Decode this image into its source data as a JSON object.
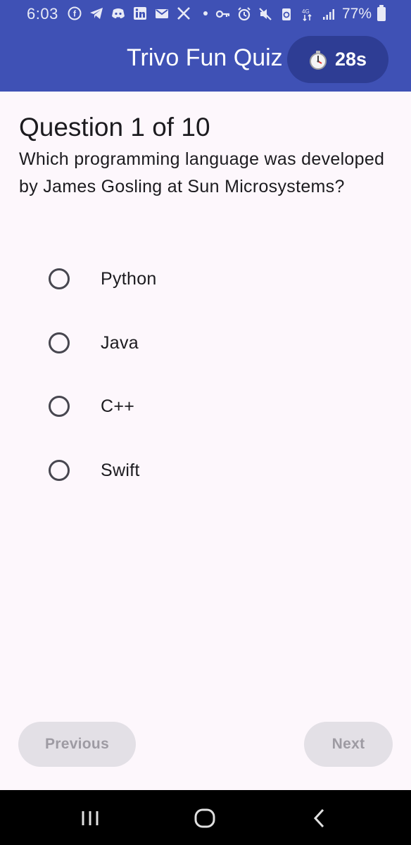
{
  "status_bar": {
    "time": "6:03",
    "battery_percent": "77%",
    "left_icons": [
      "facebook-icon",
      "telegram-icon",
      "discord-icon",
      "linkedin-icon",
      "mail-icon",
      "x-icon",
      "dot-icon"
    ],
    "right_icons": [
      "key-icon",
      "alarm-icon",
      "mute-icon",
      "data-saver-icon",
      "data-transfer-icon",
      "signal-icon",
      "battery-icon"
    ]
  },
  "app_bar": {
    "title": "Trivo Fun Quiz",
    "timer_icon": "stopwatch-icon",
    "timer_text": "28s"
  },
  "question": {
    "title": "Question 1 of 10",
    "text": "Which programming language was developed by James Gosling at Sun Microsystems?"
  },
  "options": [
    {
      "label": "Python",
      "selected": false
    },
    {
      "label": "Java",
      "selected": false
    },
    {
      "label": "C++",
      "selected": false
    },
    {
      "label": "Swift",
      "selected": false
    }
  ],
  "buttons": {
    "previous": "Previous",
    "next": "Next"
  },
  "nav_bar": {
    "icons": [
      "recent-apps-icon",
      "home-icon",
      "back-icon"
    ]
  },
  "colors": {
    "primary": "#3f51b5",
    "timer_chip": "#2e3d94",
    "background": "#fdf7fc",
    "button_disabled_bg": "#e3e0e6",
    "button_disabled_text": "#9e9ba3"
  }
}
